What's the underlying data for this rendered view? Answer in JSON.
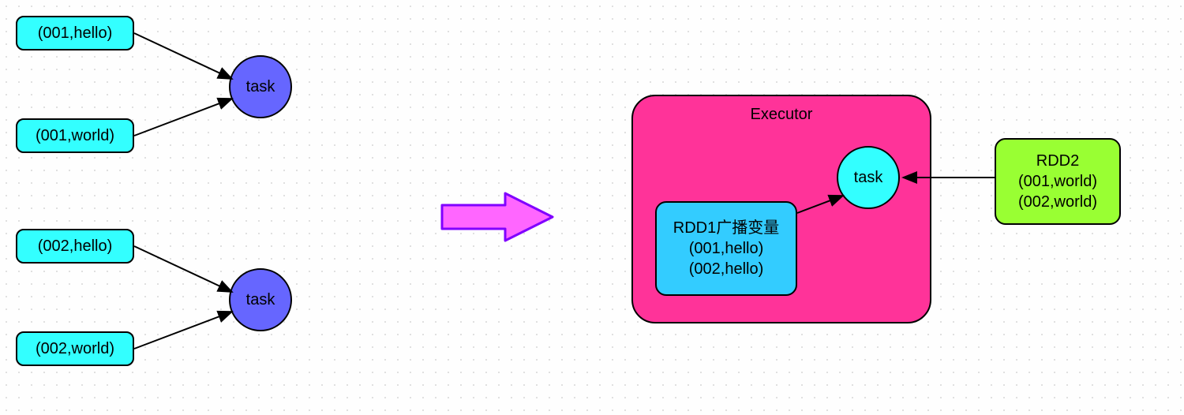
{
  "left": {
    "tuple1": "(001,hello)",
    "tuple2": "(001,world)",
    "tuple3": "(002,hello)",
    "tuple4": "(002,world)",
    "task1": "task",
    "task2": "task"
  },
  "right": {
    "executor_label": "Executor",
    "rdd1_text": "RDD1广播变量\n(001,hello)\n(002,hello)",
    "task": "task",
    "rdd2_text": "RDD2\n(001,world)\n(002,world)"
  }
}
